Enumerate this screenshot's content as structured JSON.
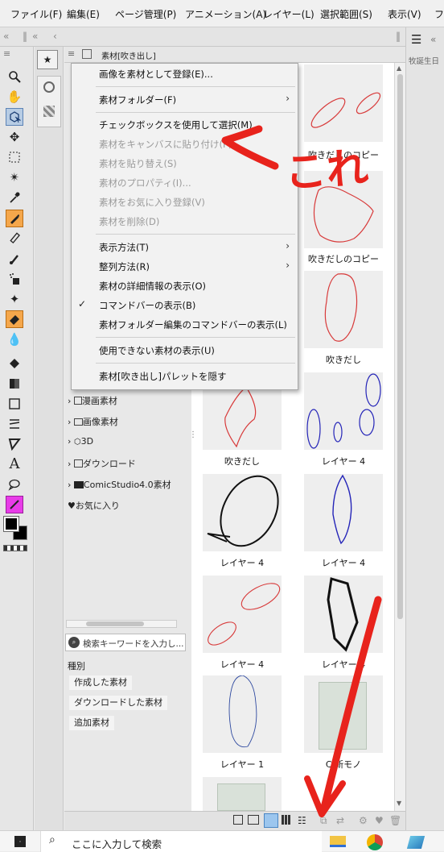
{
  "menubar": {
    "items": [
      "ファイル(F)",
      "編集(E)",
      "ページ管理(P)",
      "アニメーション(A)",
      "レイヤー(L)",
      "選択範囲(S)",
      "表示(V)",
      "フ"
    ]
  },
  "palette": {
    "tab_label": "素材[吹き出し]"
  },
  "right_panel": {
    "text": "牧誕生日"
  },
  "context_menu": {
    "items": [
      {
        "label": "画像を素材として登録(E)...",
        "disabled": false
      },
      {
        "label": "素材フォルダー(F)",
        "disabled": false,
        "submenu": true
      },
      {
        "label": "チェックボックスを使用して選択(M)",
        "disabled": false
      },
      {
        "label": "素材をキャンバスに貼り付け(P)",
        "disabled": true
      },
      {
        "label": "素材を貼り替え(S)",
        "disabled": true
      },
      {
        "label": "素材のプロパティ(I)...",
        "disabled": true
      },
      {
        "label": "素材をお気に入り登録(V)",
        "disabled": true
      },
      {
        "label": "素材を削除(D)",
        "disabled": true
      },
      {
        "label": "表示方法(T)",
        "disabled": false,
        "submenu": true
      },
      {
        "label": "整列方法(R)",
        "disabled": false,
        "submenu": true
      },
      {
        "label": "素材の詳細情報の表示(O)",
        "disabled": false
      },
      {
        "label": "コマンドバーの表示(B)",
        "disabled": false,
        "checked": true
      },
      {
        "label": "素材フォルダー編集のコマンドバーの表示(L)",
        "disabled": false
      },
      {
        "label": "使用できない素材の表示(U)",
        "disabled": false
      },
      {
        "label": "素材[吹き出し]パレットを隠す",
        "disabled": false
      }
    ]
  },
  "tree": {
    "items": [
      "漫画素材",
      "画像素材",
      "3D",
      "ダウンロード",
      "ComicStudio4.0素材",
      "お気に入り"
    ]
  },
  "search": {
    "placeholder": "検索キーワードを入力し..."
  },
  "filter": {
    "heading": "種別",
    "buttons": [
      "作成した素材",
      "ダウンロードした素材",
      "追加素材"
    ]
  },
  "thumbnails": [
    {
      "label": ""
    },
    {
      "label": "吹きだしのコピー"
    },
    {
      "label": ""
    },
    {
      "label": "吹きだしのコピー"
    },
    {
      "label": ""
    },
    {
      "label": "吹きだし"
    },
    {
      "label": "吹きだし"
    },
    {
      "label": "レイヤー 4"
    },
    {
      "label": "レイヤー 4"
    },
    {
      "label": "レイヤー 4"
    },
    {
      "label": "レイヤー 4"
    },
    {
      "label": "レイヤー 4"
    },
    {
      "label": "レイヤー 1"
    },
    {
      "label": "C 新モノ"
    },
    {
      "label": ""
    }
  ],
  "annotation": {
    "text": "これ",
    "color": "#e8231c"
  },
  "taskbar": {
    "search_text": "ここに入力して検索"
  },
  "colors": {
    "accent": "#f5a74b",
    "annotation": "#e8231c",
    "magenta": "#e83ce8"
  }
}
